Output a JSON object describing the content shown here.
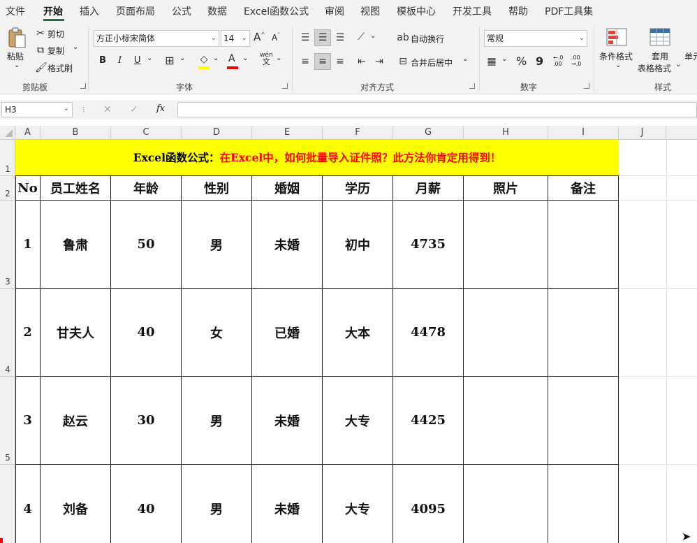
{
  "menu": {
    "tabs": [
      "文件",
      "开始",
      "插入",
      "页面布局",
      "公式",
      "数据",
      "Excel函数公式",
      "审阅",
      "视图",
      "模板中心",
      "开发工具",
      "帮助",
      "PDF工具集"
    ],
    "active": "开始"
  },
  "ribbon": {
    "clipboard": {
      "paste": "粘贴",
      "cut": "剪切",
      "copy": "复制",
      "format_painter": "格式刷",
      "label": "剪贴板"
    },
    "font": {
      "name": "方正小标宋简体",
      "size": "14",
      "bold": "B",
      "italic": "I",
      "underline": "U",
      "font_color_glyph": "A",
      "grow": "A",
      "shrink": "A",
      "phonetic": "wén",
      "phonetic_char": "文",
      "label": "字体",
      "highlight_color": "#ffff00",
      "font_color": "#ff0000"
    },
    "alignment": {
      "wrap_text": "自动换行",
      "merge_center": "合并后居中",
      "label": "对齐方式"
    },
    "number": {
      "format": "常规",
      "percent": "%",
      "comma": "9",
      "increase_decimal": "←.0 .00",
      "decrease_decimal": ".00 →.0",
      "label": "数字"
    },
    "styles": {
      "conditional_formatting": "条件格式",
      "format_as_table_line1": "套用",
      "format_as_table_line2": "表格格式",
      "cell_styles": "单元",
      "label": "样式"
    }
  },
  "formula_bar": {
    "name_box": "H3",
    "cancel": "✕",
    "enter": "✓",
    "fx": "fx",
    "value": ""
  },
  "columns": [
    "A",
    "B",
    "C",
    "D",
    "E",
    "F",
    "G",
    "H",
    "I",
    "J"
  ],
  "rows": [
    "1",
    "2",
    "3",
    "4",
    "5"
  ],
  "sheet": {
    "title_black": "Excel函数公式：",
    "title_red": "在Excel中，如何批量导入证件照？此方法你肯定用得到！",
    "title_black_color": "#000000",
    "title_red_color": "#ff0000",
    "title_fill": "#ffff00",
    "headers": [
      "No",
      "员工姓名",
      "年龄",
      "性别",
      "婚姻",
      "学历",
      "月薪",
      "照片",
      "备注"
    ],
    "records": [
      [
        "1",
        "鲁肃",
        "50",
        "男",
        "未婚",
        "初中",
        "4735",
        "",
        ""
      ],
      [
        "2",
        "甘夫人",
        "40",
        "女",
        "已婚",
        "大本",
        "4478",
        "",
        ""
      ],
      [
        "3",
        "赵云",
        "30",
        "男",
        "未婚",
        "大专",
        "4425",
        "",
        ""
      ],
      [
        "4",
        "刘备",
        "40",
        "男",
        "未婚",
        "大专",
        "4095",
        "",
        ""
      ]
    ]
  },
  "accent_color": "#217346"
}
